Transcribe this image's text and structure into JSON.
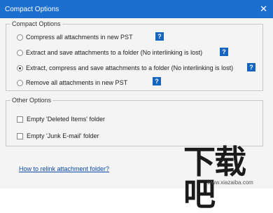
{
  "window": {
    "title": "Compact Options",
    "close_glyph": "✕"
  },
  "compact_group": {
    "legend": "Compact Options",
    "options": [
      {
        "label": "Compress all attachments in new PST",
        "checked": false,
        "help": "?"
      },
      {
        "label": "Extract and save attachments to a folder (No interlinking is lost)",
        "checked": false,
        "help": "?"
      },
      {
        "label": "Extract, compress and save attachments to a folder (No interlinking is lost)",
        "checked": true,
        "help": "?"
      },
      {
        "label": "Remove all attachments in new PST",
        "checked": false,
        "help": "?"
      }
    ]
  },
  "other_group": {
    "legend": "Other Options",
    "options": [
      {
        "label": "Empty 'Deleted Items' folder",
        "checked": false
      },
      {
        "label": "Empty 'Junk E-mail' folder",
        "checked": false
      }
    ]
  },
  "link": {
    "text": "How to relink attachment folder?"
  },
  "watermark": {
    "logo": "下载吧",
    "url": "www.xiazaiba.com"
  },
  "colors": {
    "titlebar": "#1d6fcf",
    "help_button": "#1565c0",
    "link": "#0b4aa8"
  }
}
